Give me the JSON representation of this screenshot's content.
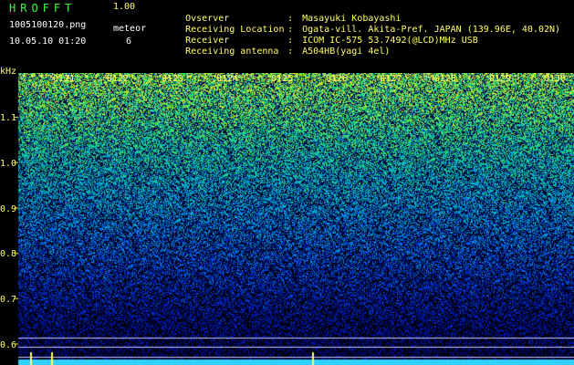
{
  "app": {
    "title": "HROFFT",
    "version": "1.00"
  },
  "file": {
    "name": "1005100120.png",
    "timestamp": "10.05.10 01:20"
  },
  "meteor": {
    "label": "meteor",
    "count": "6"
  },
  "info": [
    {
      "label": "Ovserver",
      "value": "Masayuki Kobayashi"
    },
    {
      "label": "Receiving Location",
      "value": "Ogata-vill. Akita-Pref. JAPAN (139.96E, 40.02N)"
    },
    {
      "label": "Receiver",
      "value": "ICOM IC-575 53.7492(@LCD)MHz USB"
    },
    {
      "label": "Receiving antenna",
      "value": "A504HB(yagi 4el)"
    }
  ],
  "axis": {
    "unit": "kHz",
    "y_ticks": [
      "1.1",
      "1.0",
      "0.9",
      "0.8",
      "0.7",
      "0.6"
    ],
    "x_ticks": [
      "0121",
      "0122",
      "0123",
      "0124",
      "0125",
      "0126",
      "0127",
      "0128",
      "0129",
      "0130"
    ]
  },
  "colors": {
    "header_text": "#33ff33",
    "value_text": "#ffff66",
    "background": "#000000",
    "marker_line": "#c8c8ff"
  }
}
